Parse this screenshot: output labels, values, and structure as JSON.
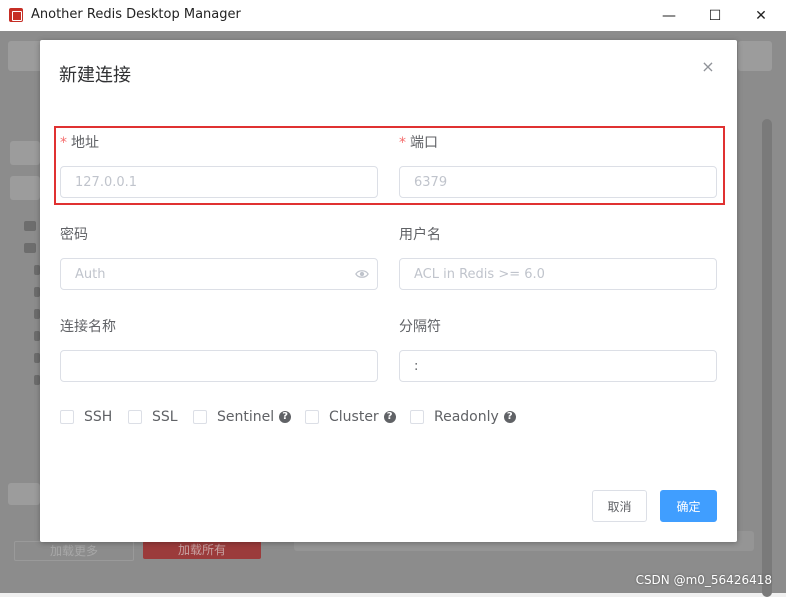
{
  "window": {
    "title": "Another Redis Desktop Manager",
    "minimize": "—",
    "maximize": "☐",
    "close": "✕"
  },
  "background": {
    "load_more": "加载更多",
    "load_all": "加载所有"
  },
  "dialog": {
    "title": "新建连接",
    "close_icon": "×",
    "fields": {
      "host": {
        "label": "地址",
        "required_mark": "*",
        "placeholder": "127.0.0.1",
        "value": ""
      },
      "port": {
        "label": "端口",
        "required_mark": "*",
        "placeholder": "6379",
        "value": ""
      },
      "password": {
        "label": "密码",
        "placeholder": "Auth",
        "value": ""
      },
      "username": {
        "label": "用户名",
        "placeholder": "ACL in Redis >= 6.0",
        "value": ""
      },
      "name": {
        "label": "连接名称",
        "placeholder": "",
        "value": ""
      },
      "separator": {
        "label": "分隔符",
        "placeholder": "",
        "value": ":"
      }
    },
    "options": [
      {
        "label": "SSH",
        "checked": false,
        "help": false
      },
      {
        "label": "SSL",
        "checked": false,
        "help": false
      },
      {
        "label": "Sentinel",
        "checked": false,
        "help": true
      },
      {
        "label": "Cluster",
        "checked": false,
        "help": true
      },
      {
        "label": "Readonly",
        "checked": false,
        "help": true
      }
    ],
    "cancel_label": "取消",
    "ok_label": "确定"
  },
  "watermark": "CSDN @m0_56426418",
  "colors": {
    "primary": "#409eff",
    "required": "#f56c6c",
    "highlight_border": "#e03131",
    "overlay": "#8c8c8c"
  }
}
